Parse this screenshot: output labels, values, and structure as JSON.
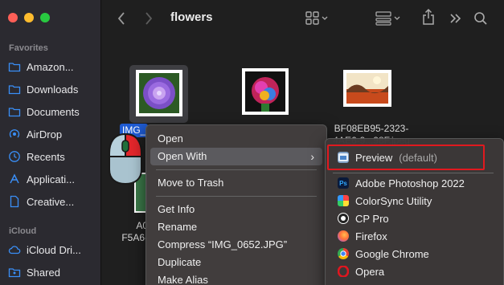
{
  "window": {
    "traffic_lights": [
      "close",
      "minimize",
      "zoom"
    ],
    "title": "flowers"
  },
  "sidebar": {
    "favorites_header": "Favorites",
    "favorites": [
      {
        "label": "Amazon...",
        "icon": "folder-icon"
      },
      {
        "label": "Downloads",
        "icon": "folder-icon"
      },
      {
        "label": "Documents",
        "icon": "folder-icon"
      },
      {
        "label": "AirDrop",
        "icon": "airdrop-icon"
      },
      {
        "label": "Recents",
        "icon": "clock-icon"
      },
      {
        "label": "Applicati...",
        "icon": "applications-icon"
      },
      {
        "label": "Creative...",
        "icon": "document-icon"
      }
    ],
    "icloud_header": "iCloud",
    "icloud": [
      {
        "label": "iCloud Dri...",
        "icon": "cloud-icon"
      },
      {
        "label": "Shared",
        "icon": "shared-folder-icon"
      }
    ]
  },
  "files": {
    "selected_name": "IMG_",
    "third_name_line1": "BF08EB95-2323-",
    "third_name_line2": "4AE6-9...98F.jpeg",
    "partial_name_line1": "A0",
    "partial_name_line2": "F5A6-"
  },
  "context_menu": {
    "items": [
      "Open",
      "Open With",
      "Move to Trash",
      "Get Info",
      "Rename",
      "Compress “IMG_0652.JPG”",
      "Duplicate",
      "Make Alias"
    ]
  },
  "open_with_menu": {
    "default_app": "Preview",
    "default_note": "(default)",
    "apps": [
      {
        "label": "Adobe Photoshop 2022",
        "icon": "photoshop-icon",
        "color": "#0a1a3a"
      },
      {
        "label": "ColorSync Utility",
        "icon": "colorsync-icon",
        "color": "#e05ab0"
      },
      {
        "label": "CP Pro",
        "icon": "cp-pro-icon",
        "color": "#222222"
      },
      {
        "label": "Firefox",
        "icon": "firefox-icon",
        "color": "#ff7139"
      },
      {
        "label": "Google Chrome",
        "icon": "chrome-icon",
        "color": "#34a853"
      },
      {
        "label": "Opera",
        "icon": "opera-icon",
        "color": "#e0161f"
      }
    ]
  },
  "colors": {
    "highlight_box": "#e0191f",
    "selection_blue": "#1e5bd3"
  }
}
